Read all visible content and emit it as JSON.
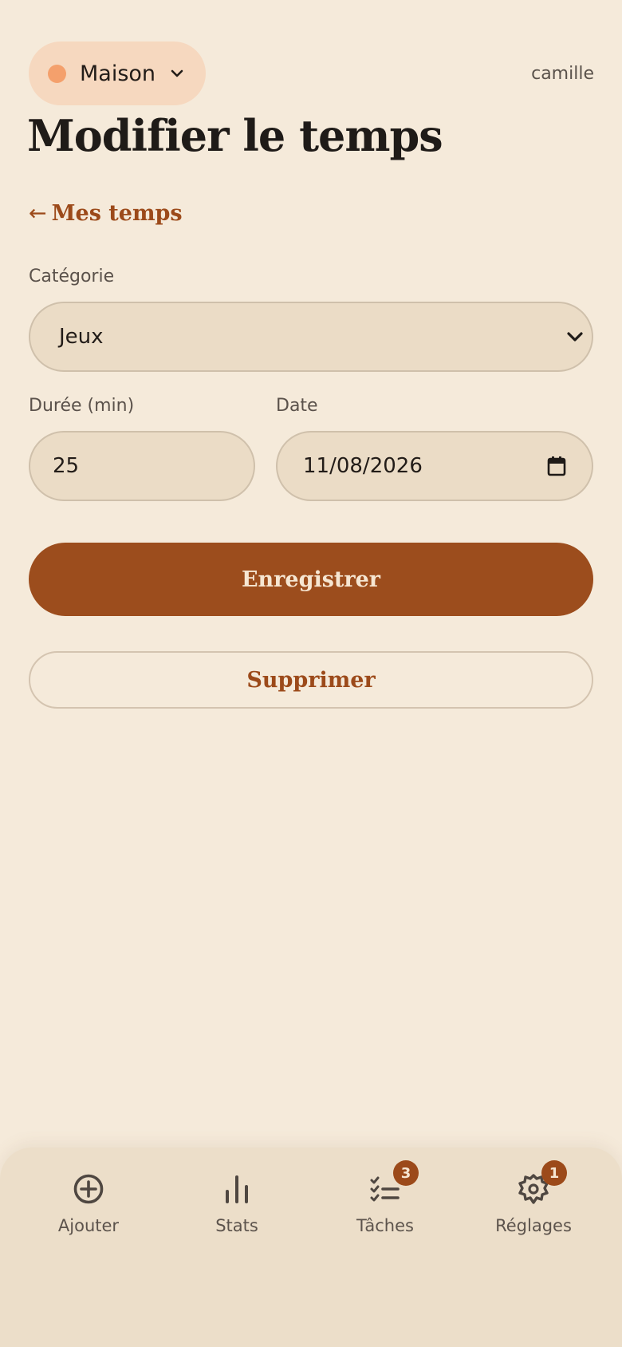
{
  "header": {
    "space_name": "Maison",
    "username": "camille"
  },
  "page": {
    "title": "Modifier le temps",
    "back_link": "Mes temps",
    "back_arrow": "←"
  },
  "form": {
    "category_label": "Catégorie",
    "category_value": "Jeux",
    "duration_label": "Durée (min)",
    "duration_value": "25",
    "date_label": "Date",
    "date_value": "11/08/2026",
    "save_label": "Enregistrer",
    "delete_label": "Supprimer"
  },
  "nav": {
    "items": [
      {
        "label": "Ajouter",
        "icon": "plus-circle-icon"
      },
      {
        "label": "Stats",
        "icon": "bar-chart-icon"
      },
      {
        "label": "Tâches",
        "icon": "checklist-icon",
        "badge": "3"
      },
      {
        "label": "Réglages",
        "icon": "gear-icon",
        "badge": "1"
      }
    ]
  },
  "colors": {
    "background": "#f5eada",
    "accent": "#9c4d1d",
    "space_dot": "#f4a06c",
    "chip_bg": "#f6d8bf"
  }
}
